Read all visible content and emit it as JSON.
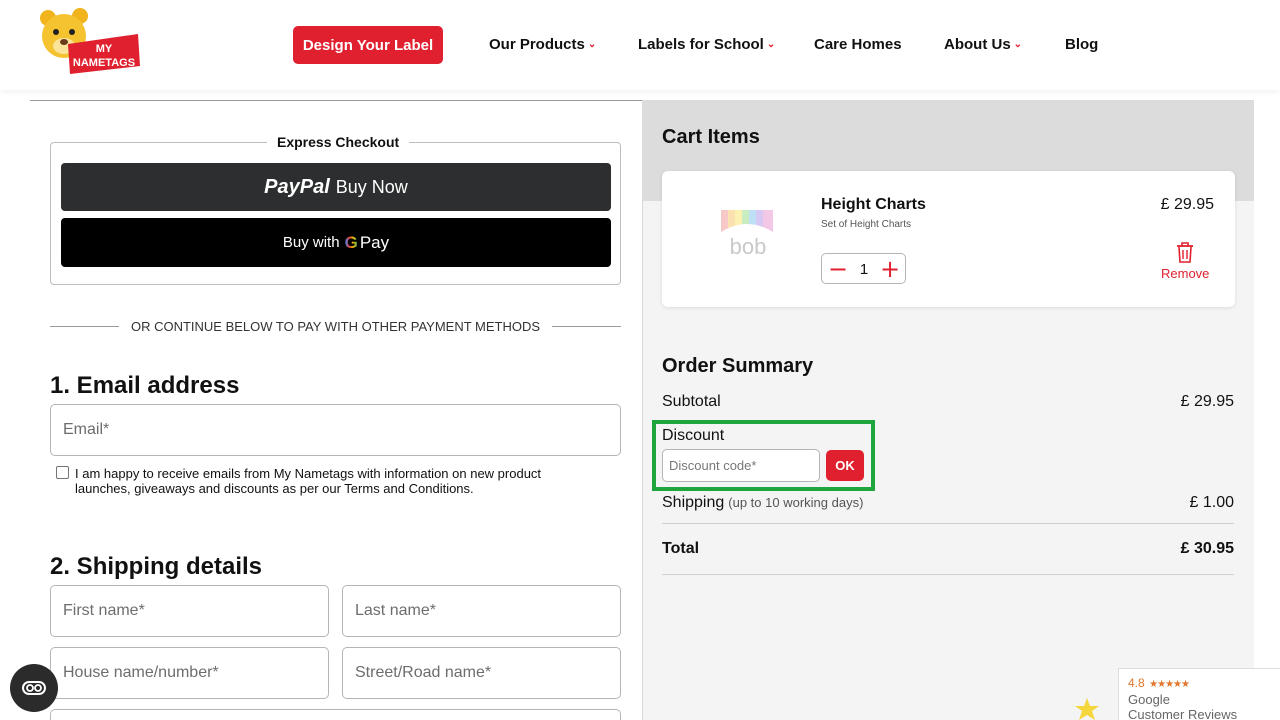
{
  "brand": {
    "logo_line1": "MY",
    "logo_line2": "NAMETAGS",
    "accent": "#e0202e"
  },
  "header": {
    "design_button": "Design Your Label",
    "nav": [
      {
        "label": "Our Products",
        "dropdown": true
      },
      {
        "label": "Labels for School",
        "dropdown": true
      },
      {
        "label": "Care Homes",
        "dropdown": false
      },
      {
        "label": "About Us",
        "dropdown": true
      },
      {
        "label": "Blog",
        "dropdown": false
      }
    ],
    "chevron": "⌄"
  },
  "express": {
    "title": "Express Checkout",
    "paypal_logo": "PayPal",
    "paypal_text": "Buy Now",
    "gpay_prefix": "Buy with",
    "gpay_g": "G",
    "gpay_suffix": "Pay"
  },
  "divider_text": "OR CONTINUE BELOW TO PAY WITH OTHER PAYMENT METHODS",
  "email_section": {
    "title": "1. Email address",
    "email_placeholder": "Email*",
    "consent": "I am happy to receive emails from My Nametags with information on new product launches, giveaways and discounts as per our Terms and Conditions.",
    "consent_checked": false
  },
  "shipping_section": {
    "title": "2. Shipping details",
    "first_name_placeholder": "First name*",
    "last_name_placeholder": "Last name*",
    "house_placeholder": "House name/number*",
    "street_placeholder": "Street/Road name*"
  },
  "cart": {
    "title": "Cart Items",
    "item": {
      "name": "Height Charts",
      "subtitle": "Set of Height Charts",
      "price": "£ 29.95",
      "quantity": "1",
      "thumb_text": "bob",
      "remove_label": "Remove"
    }
  },
  "summary": {
    "title": "Order Summary",
    "subtotal_label": "Subtotal",
    "subtotal_value": "£ 29.95",
    "discount_label": "Discount",
    "discount_placeholder": "Discount code*",
    "ok_label": "OK",
    "shipping_label": "Shipping",
    "shipping_note": "(up to 10 working days)",
    "shipping_value": "£ 1.00",
    "total_label": "Total",
    "total_value": "£ 30.95"
  },
  "google_reviews": {
    "rating": "4.8",
    "stars": "★★★★★",
    "line1": "Google",
    "line2": "Customer Reviews"
  },
  "icons": {
    "a11y": "accessibility-icon",
    "trash": "trash-icon"
  },
  "highlight_color": "#1fa53e"
}
